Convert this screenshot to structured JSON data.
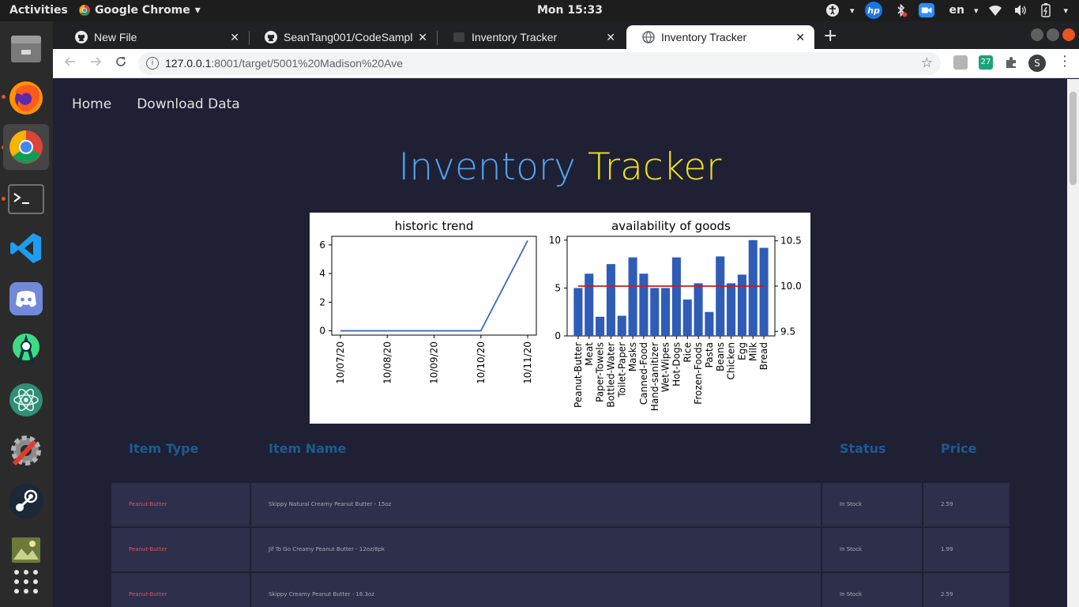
{
  "system": {
    "activities": "Activities",
    "app_name": "Google Chrome",
    "clock": "Mon 15:33",
    "language": "en"
  },
  "browser": {
    "tabs": [
      {
        "title": "New File"
      },
      {
        "title": "SeanTang001/CodeSampl"
      },
      {
        "title": "Inventory Tracker"
      },
      {
        "title": "Inventory Tracker"
      }
    ],
    "url_host": "127.0.0.1",
    "url_rest": ":8001/target/5001%20Madison%20Ave",
    "profile_initial": "S",
    "ext_badge": "27"
  },
  "nav": {
    "home": "Home",
    "download": "Download Data"
  },
  "heading": {
    "word1": "Inventory",
    "word2": "Tracker"
  },
  "chart_data": [
    {
      "type": "line",
      "title": "historic trend",
      "x": [
        "10/07/20",
        "10/08/20",
        "10/09/20",
        "10/10/20",
        "10/11/20"
      ],
      "values": [
        0,
        0,
        0,
        0,
        6.3
      ],
      "yticks": [
        0,
        2,
        4,
        6
      ],
      "ylim": [
        -0.3,
        6.6
      ],
      "color": "#3a6cc0"
    },
    {
      "type": "bar",
      "title": "availability of goods",
      "categories": [
        "Peanut-Butter",
        "Meat",
        "Paper-Towels",
        "Bottled-Water",
        "Toilet-Paper",
        "Masks",
        "Canned-Food",
        "Hand-sanitizer",
        "Wet-Wipes",
        "Hot-Dogs",
        "Rice",
        "Frozen-Foods",
        "Pasta",
        "Beans",
        "Chicken",
        "Egg",
        "Milk",
        "Bread"
      ],
      "values": [
        5.0,
        6.5,
        2.0,
        7.5,
        2.1,
        8.2,
        6.5,
        5.0,
        5.0,
        8.2,
        3.8,
        5.5,
        2.5,
        8.3,
        5.5,
        6.4,
        10.0,
        9.2
      ],
      "ylim": [
        0,
        10.4
      ],
      "yticks": [
        0,
        5,
        10
      ],
      "y2ticks": [
        9.5,
        10.0,
        10.5
      ],
      "y2lim": [
        9.45,
        10.55
      ],
      "line_value": 10.0,
      "bar_color": "#2f5cb6",
      "line_color": "#cc1a1a"
    }
  ],
  "table": {
    "headers": {
      "type": "Item Type",
      "name": "Item Name",
      "status": "Status",
      "price": "Price"
    },
    "rows": [
      {
        "type": "Peanut-Butter",
        "name": "Skippy Natural Creamy Peanut Butter - 15oz",
        "status": "In Stock",
        "price": "2.59"
      },
      {
        "type": "Peanut-Butter",
        "name": "Jif To Go Creamy Peanut Butter - 12oz/8pk",
        "status": "In Stock",
        "price": "1.99"
      },
      {
        "type": "Peanut-Butter",
        "name": "Skippy Creamy Peanut Butter - 16.3oz",
        "status": "In Stock",
        "price": "2.59"
      }
    ]
  }
}
